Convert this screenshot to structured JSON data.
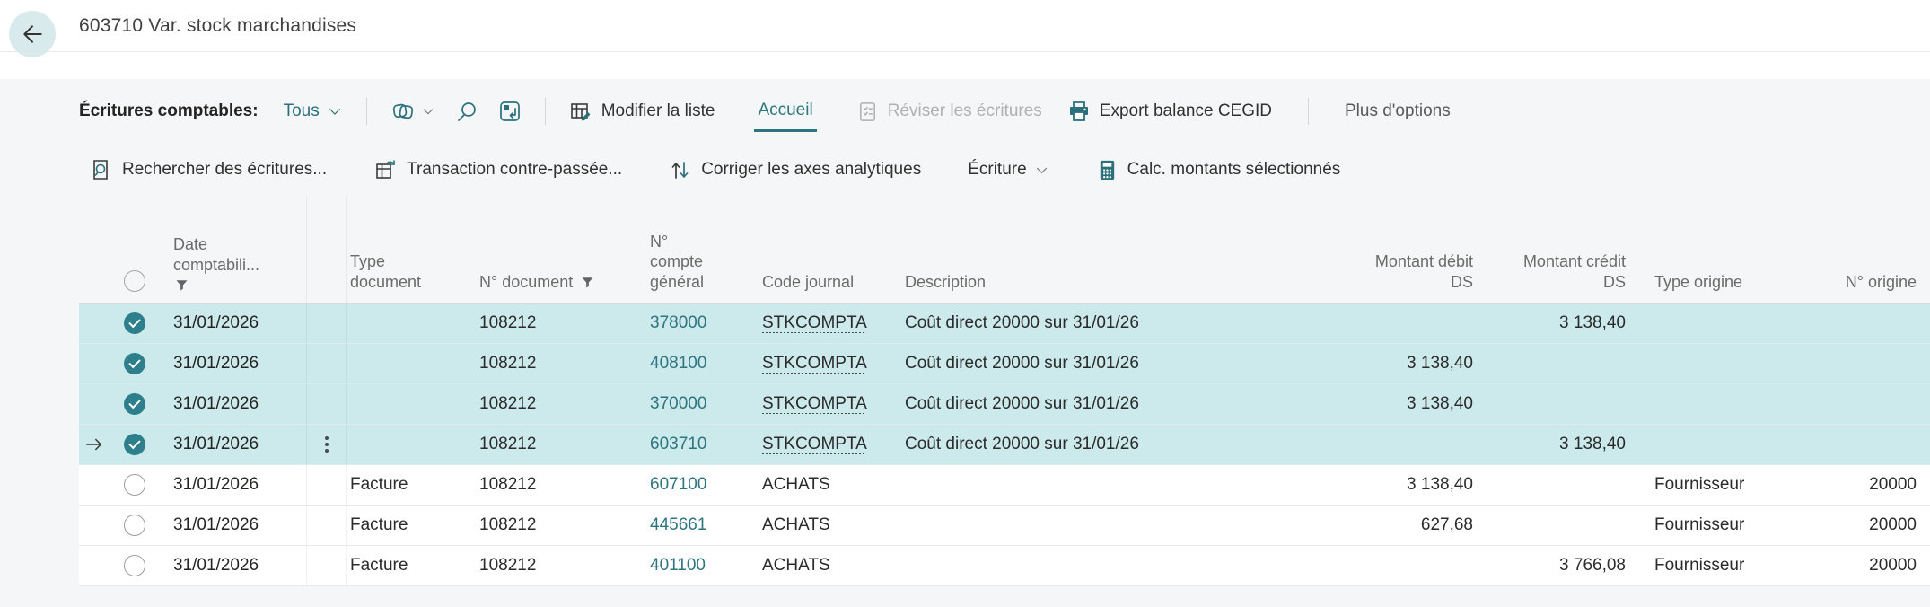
{
  "page": {
    "title": "603710 Var. stock marchandises"
  },
  "cmdbar": {
    "caption": "Écritures comptables:",
    "view_filter": "Tous",
    "edit_list": "Modifier la liste",
    "home_tab": "Accueil",
    "review_entries": "Réviser les écritures",
    "export_cegid": "Export balance CEGID",
    "more_options": "Plus d'options"
  },
  "actions": {
    "find_entries": "Rechercher des écritures...",
    "reverse_transaction": "Transaction contre-passée...",
    "correct_dimensions": "Corriger les axes analytiques",
    "entry_menu": "Écriture",
    "calc_selected": "Calc. montants sélectionnés"
  },
  "icons": {
    "back": "arrow-left",
    "view_dropdown": "chevron-down",
    "analyze": "overlapping-cards",
    "search": "magnifier",
    "focus": "frame-rotate-arrow",
    "edit_list": "grid-pencil",
    "review": "document-checklist",
    "export": "printer",
    "find": "document-magnifier",
    "reverse": "grid-undo-arrow",
    "dimensions": "up-down-arrows",
    "calc": "calculator",
    "filter": "funnel",
    "row_menu": "vertical-dots",
    "current_row": "arrow-right"
  },
  "colors": {
    "accent": "#2b7780",
    "link": "#2f7580",
    "selection_bg": "#cce9eb",
    "checkbox": "#2e7f8c",
    "page_bg": "#f5f6f7",
    "disabled": "#b0b0b0"
  },
  "table": {
    "columns": [
      {
        "label": "Date comptabili...",
        "filtered": true
      },
      {
        "label": "Type document"
      },
      {
        "label": "N° document",
        "filtered": true
      },
      {
        "label": "N° compte général"
      },
      {
        "label": "Code journal"
      },
      {
        "label": "Description"
      },
      {
        "label": "Montant débit DS",
        "align": "right"
      },
      {
        "label": "Montant crédit DS",
        "align": "right"
      },
      {
        "label": "Type origine"
      },
      {
        "label": "N° origine",
        "align": "right"
      }
    ],
    "rows": [
      {
        "selected": true,
        "current": false,
        "menu": false,
        "date": "31/01/2026",
        "doc_type": "",
        "doc_no": "108212",
        "account": "378000",
        "journal": "STKCOMPTA",
        "journal_dotted": true,
        "description": "Coût direct 20000 sur 31/01/26",
        "debit": "",
        "credit": "3 138,40",
        "origin_type": "",
        "origin_no": ""
      },
      {
        "selected": true,
        "current": false,
        "menu": false,
        "date": "31/01/2026",
        "doc_type": "",
        "doc_no": "108212",
        "account": "408100",
        "journal": "STKCOMPTA",
        "journal_dotted": true,
        "description": "Coût direct 20000 sur 31/01/26",
        "debit": "3 138,40",
        "credit": "",
        "origin_type": "",
        "origin_no": ""
      },
      {
        "selected": true,
        "current": false,
        "menu": false,
        "date": "31/01/2026",
        "doc_type": "",
        "doc_no": "108212",
        "account": "370000",
        "journal": "STKCOMPTA",
        "journal_dotted": true,
        "description": "Coût direct 20000 sur 31/01/26",
        "debit": "3 138,40",
        "credit": "",
        "origin_type": "",
        "origin_no": ""
      },
      {
        "selected": true,
        "current": true,
        "menu": true,
        "date": "31/01/2026",
        "doc_type": "",
        "doc_no": "108212",
        "account": "603710",
        "journal": "STKCOMPTA",
        "journal_dotted": true,
        "description": "Coût direct 20000 sur 31/01/26",
        "debit": "",
        "credit": "3 138,40",
        "origin_type": "",
        "origin_no": ""
      },
      {
        "selected": false,
        "current": false,
        "menu": false,
        "date": "31/01/2026",
        "doc_type": "Facture",
        "doc_no": "108212",
        "account": "607100",
        "journal": "ACHATS",
        "journal_dotted": false,
        "description": "",
        "debit": "3 138,40",
        "credit": "",
        "origin_type": "Fournisseur",
        "origin_no": "20000"
      },
      {
        "selected": false,
        "current": false,
        "menu": false,
        "date": "31/01/2026",
        "doc_type": "Facture",
        "doc_no": "108212",
        "account": "445661",
        "journal": "ACHATS",
        "journal_dotted": false,
        "description": "",
        "debit": "627,68",
        "credit": "",
        "origin_type": "Fournisseur",
        "origin_no": "20000"
      },
      {
        "selected": false,
        "current": false,
        "menu": false,
        "date": "31/01/2026",
        "doc_type": "Facture",
        "doc_no": "108212",
        "account": "401100",
        "journal": "ACHATS",
        "journal_dotted": false,
        "description": "",
        "debit": "",
        "credit": "3 766,08",
        "origin_type": "Fournisseur",
        "origin_no": "20000"
      }
    ]
  }
}
